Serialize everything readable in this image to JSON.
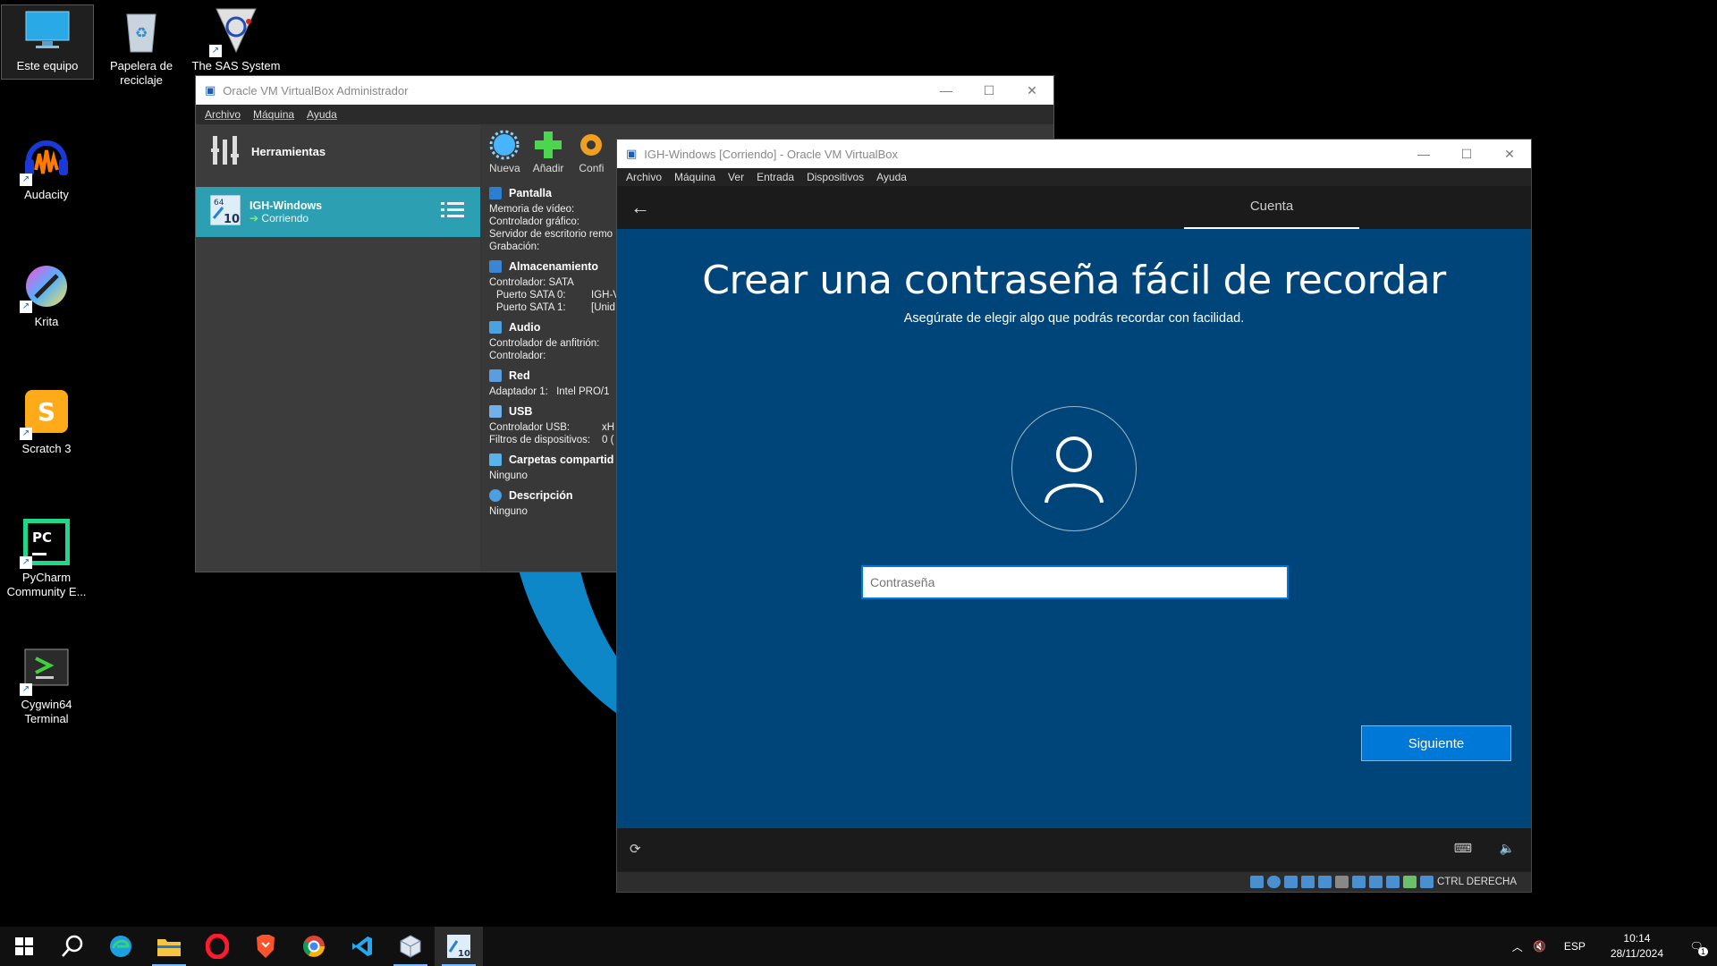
{
  "desktop": {
    "icons": [
      {
        "label": "Este equipo",
        "icon": "monitor-icon"
      },
      {
        "label": "Papelera de reciclaje",
        "icon": "recycle-bin-icon"
      },
      {
        "label": "The SAS System",
        "icon": "sas-icon"
      },
      {
        "label": "Audacity",
        "icon": "audacity-icon"
      },
      {
        "label": "Krita",
        "icon": "krita-icon"
      },
      {
        "label": "Scratch 3",
        "icon": "scratch-icon"
      },
      {
        "label": "PyCharm Community E...",
        "icon": "pycharm-icon"
      },
      {
        "label": "Cygwin64 Terminal",
        "icon": "cygwin-icon"
      }
    ]
  },
  "manager": {
    "title": "Oracle VM VirtualBox Administrador",
    "menu": [
      "Archivo",
      "Máquina",
      "Ayuda"
    ],
    "tools_label": "Herramientas",
    "vm_name": "IGH-Windows",
    "vm_state": "Corriendo",
    "toolbar": [
      "Nueva",
      "Añadir",
      "Confi"
    ],
    "details": {
      "pantalla": {
        "title": "Pantalla",
        "lines": [
          "Memoria de vídeo:",
          "Controlador gráfico:",
          "Servidor de escritorio remo",
          "Grabación:"
        ]
      },
      "almacenamiento": {
        "title": "Almacenamiento",
        "lines": [
          "Controlador: SATA"
        ],
        "ports": [
          [
            "Puerto SATA 0:",
            "IGH-V"
          ],
          [
            "Puerto SATA 1:",
            "[Unid"
          ]
        ]
      },
      "audio": {
        "title": "Audio",
        "lines": [
          "Controlador de anfitrión:",
          "Controlador:"
        ]
      },
      "red": {
        "title": "Red",
        "lines": [
          [
            "Adaptador 1:",
            "Intel PRO/1"
          ]
        ]
      },
      "usb": {
        "title": "USB",
        "lines": [
          [
            "Controlador USB:",
            "xH"
          ],
          [
            "Filtros de dispositivos:",
            "0 ("
          ]
        ]
      },
      "carpetas": {
        "title": "Carpetas compartid",
        "value": "Ninguno"
      },
      "descripcion": {
        "title": "Descripción",
        "value": "Ninguno"
      }
    }
  },
  "vm_window": {
    "title": "IGH-Windows [Corriendo] - Oracle VM VirtualBox",
    "menu": [
      "Archivo",
      "Máquina",
      "Ver",
      "Entrada",
      "Dispositivos",
      "Ayuda"
    ],
    "tab": "Cuenta",
    "heading": "Crear una contraseña fácil de recordar",
    "subheading": "Asegúrate de elegir algo que podrás recordar con facilidad.",
    "password_placeholder": "Contraseña",
    "next_label": "Siguiente",
    "status_host_key": "CTRL DERECHA"
  },
  "taskbar": {
    "apps": [
      "start-icon",
      "search-icon",
      "edge-icon",
      "file-explorer-icon",
      "opera-icon",
      "brave-icon",
      "chrome-icon",
      "vscode-icon",
      "virtualbox-icon",
      "vm-window-icon"
    ],
    "language": "ESP",
    "time": "10:14",
    "date": "28/11/2024",
    "notifications": "1"
  },
  "colors": {
    "oobe_blue": "#004579",
    "accent": "#0078d7",
    "vm_selected": "#2d9fb3"
  }
}
